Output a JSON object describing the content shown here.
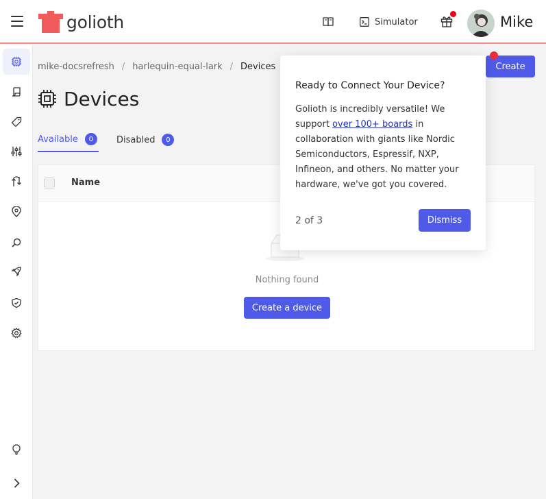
{
  "topbar": {
    "logo_text": "golioth",
    "simulator_label": "Simulator",
    "user_name": "Mike",
    "brand_color": "#f05a5a",
    "icons": [
      "menu-icon",
      "book-icon",
      "terminal-icon",
      "gift-icon"
    ]
  },
  "sidebar": {
    "items": [
      {
        "name": "devices",
        "icon": "chip-icon",
        "active": true
      },
      {
        "name": "lightdb",
        "icon": "scroll-icon"
      },
      {
        "name": "tags",
        "icon": "tag-icon"
      },
      {
        "name": "settings-sliders",
        "icon": "sliders-icon"
      },
      {
        "name": "pipelines",
        "icon": "route-icon"
      },
      {
        "name": "location",
        "icon": "pin-icon"
      },
      {
        "name": "search",
        "icon": "search-icon"
      },
      {
        "name": "deployments",
        "icon": "rocket-icon"
      },
      {
        "name": "security",
        "icon": "shield-icon"
      },
      {
        "name": "settings",
        "icon": "gear-icon"
      },
      {
        "name": "tips",
        "icon": "lightbulb-icon"
      },
      {
        "name": "expand",
        "icon": "chevron-right-icon"
      }
    ]
  },
  "breadcrumb": {
    "org": "mike-docsrefresh",
    "project": "harlequin-equal-lark",
    "current": "Devices",
    "separator": "/"
  },
  "page": {
    "title": "Devices",
    "create_label": "Create"
  },
  "tabs": [
    {
      "label": "Available",
      "count": "0"
    },
    {
      "label": "Disabled",
      "count": "0"
    }
  ],
  "table": {
    "columns": [
      "Name"
    ],
    "empty_text": "Nothing found",
    "create_device_label": "Create a device"
  },
  "popover": {
    "title": "Ready to Connect Your Device?",
    "body_before": "Golioth is incredibly versatile! We support ",
    "link_text": "over 100+ boards",
    "body_after": " in collaboration with giants like Nordic Semiconductors, Espressif, NXP, Infineon, and others. No matter your hardware, we've got you covered.",
    "step": "2 of 3",
    "dismiss_label": "Dismiss"
  },
  "accent_color": "#4f5be8"
}
